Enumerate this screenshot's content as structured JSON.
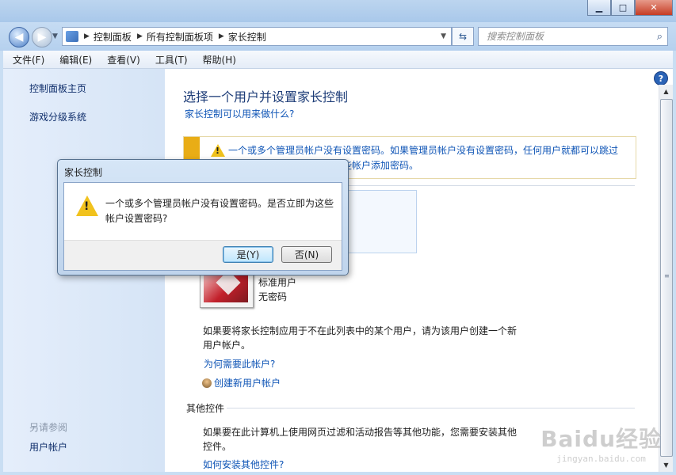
{
  "window": {
    "caption": {
      "minimize": "▁",
      "maximize": "□",
      "close": "✕"
    }
  },
  "address": {
    "breadcrumbs": [
      "控制面板",
      "所有控制面板项",
      "家长控制"
    ],
    "search_placeholder": "搜索控制面板"
  },
  "menu": [
    "文件(F)",
    "编辑(E)",
    "查看(V)",
    "工具(T)",
    "帮助(H)"
  ],
  "sidebar": {
    "links": [
      "控制面板主页",
      "游戏分级系统"
    ],
    "see_also_label": "另请参阅",
    "see_also_links": [
      "用户帐户"
    ]
  },
  "main": {
    "title": "选择一个用户并设置家长控制",
    "what_link": "家长控制可以用来做什么?",
    "warning": {
      "line1": "一个或多个管理员帐户没有设置密码。如果管理员帐户没有设置密码，任何用户就都可以跳过",
      "line2": "家长控制。单击此处以为这些帐户添加密码。"
    },
    "user": {
      "type": "标准用户",
      "password": "无密码"
    },
    "create_info": "如果要将家长控制应用于不在此列表中的某个用户，请为该用户创建一个新用户帐户。",
    "why_link": "为何需要此帐户?",
    "create_link": "创建新用户帐户",
    "other_section": "其他控件",
    "other_info": "如果要在此计算机上使用网页过滤和活动报告等其他功能，您需要安装其他控件。",
    "install_link": "如何安装其他控件?"
  },
  "dialog": {
    "title": "家长控制",
    "message": "一个或多个管理员帐户没有设置密码。是否立即为这些帐户设置密码?",
    "yes": "是(Y)",
    "no": "否(N)"
  },
  "watermark": {
    "logo": "Baidu经验",
    "url": "jingyan.baidu.com"
  },
  "colors": {
    "link": "#0f55b6",
    "warning_stripe": "#e9ad16",
    "title": "#1e3d78"
  }
}
